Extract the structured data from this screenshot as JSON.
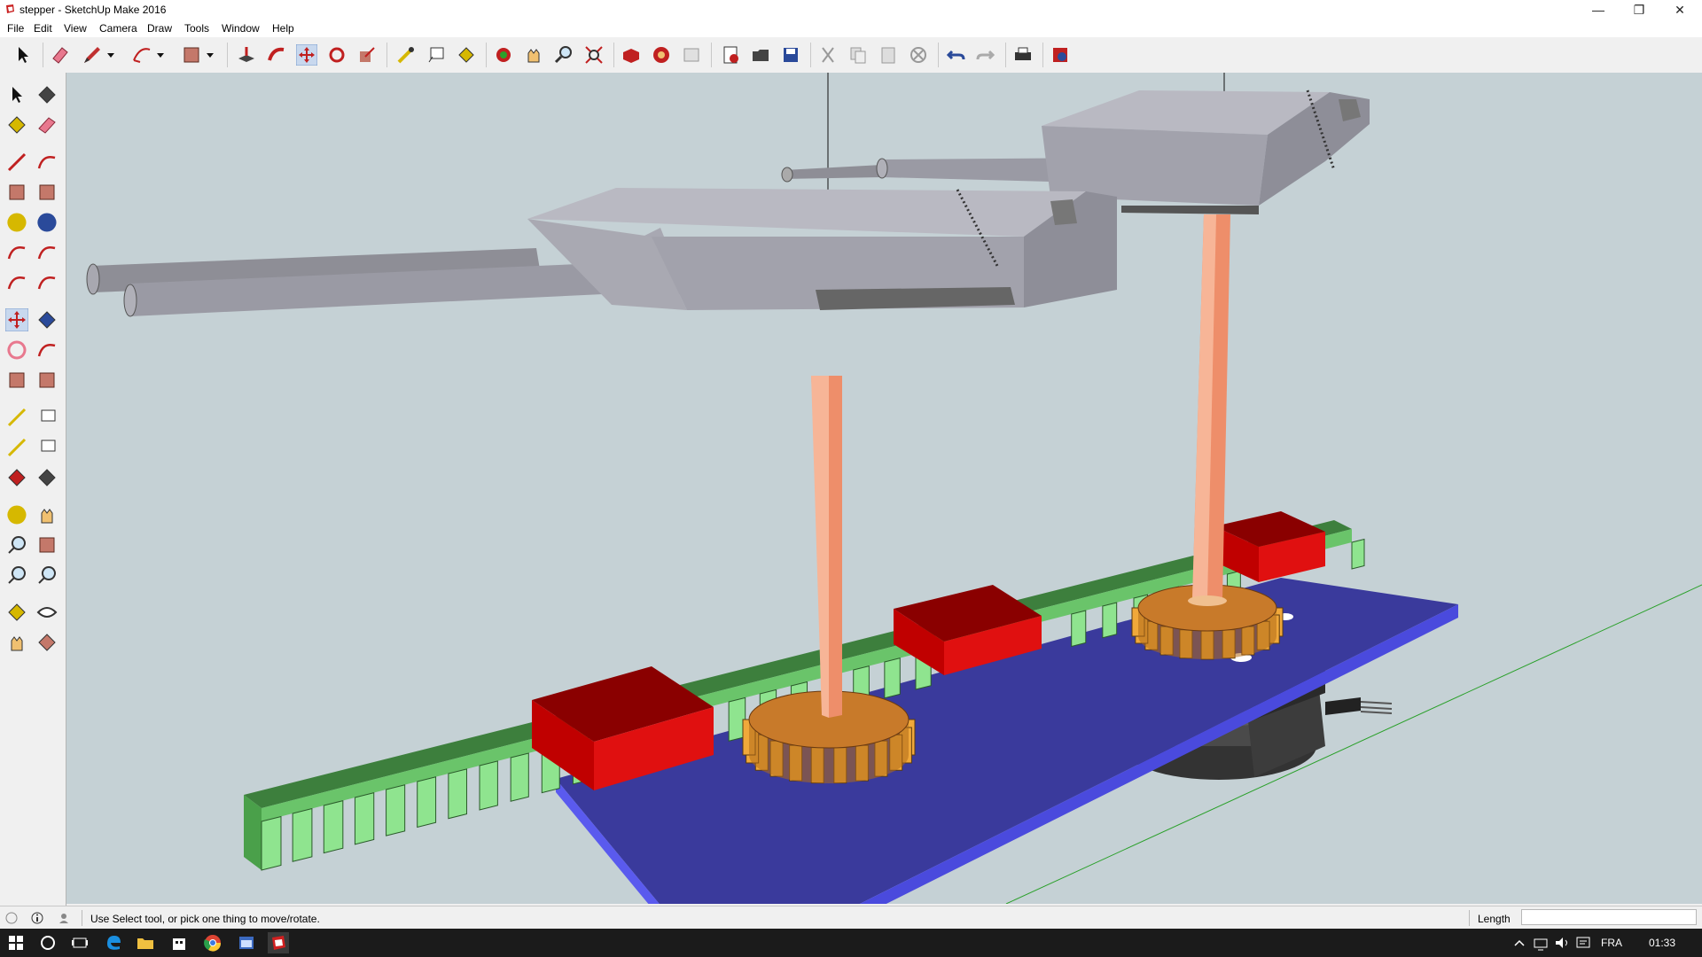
{
  "window": {
    "title": "stepper - SketchUp Make 2016",
    "icon": "sketchup-logo-icon",
    "controls": {
      "minimize": "—",
      "restore": "❐",
      "close": "✕"
    }
  },
  "menu": {
    "items": [
      "File",
      "Edit",
      "View",
      "Camera",
      "Draw",
      "Tools",
      "Window",
      "Help"
    ]
  },
  "toolbar": {
    "icons": [
      "select-icon",
      "eraser-icon",
      "pencil-icon",
      "dropdown-icon",
      "arc-icon",
      "dropdown-icon",
      "rectangle-icon",
      "dropdown-icon",
      "push-pull-icon",
      "follow-me-icon",
      "move-icon",
      "rotate-icon",
      "scale-icon",
      "tape-measure-icon",
      "text-icon",
      "paint-bucket-icon",
      "orbit-icon",
      "pan-icon",
      "zoom-icon",
      "zoom-extents-icon",
      "3d-warehouse-icon",
      "extension-warehouse-icon",
      "layout-icon",
      "new-icon",
      "open-icon",
      "save-icon",
      "cut-icon",
      "copy-icon",
      "paste-icon",
      "erase-icon",
      "undo-icon",
      "redo-icon",
      "print-icon",
      "model-info-icon"
    ]
  },
  "left_toolbar": {
    "icons": [
      "select-icon",
      "make-component-icon",
      "paint-bucket-icon",
      "eraser-icon",
      "line-icon",
      "freehand-icon",
      "rectangle-icon",
      "rotated-rectangle-icon",
      "circle-icon",
      "polygon-icon",
      "arc-icon",
      "2-point-arc-icon",
      "3-point-arc-icon",
      "pie-icon",
      "move-icon",
      "push-pull-icon",
      "rotate-icon",
      "follow-me-icon",
      "scale-icon",
      "offset-icon",
      "tape-measure-icon",
      "dimension-icon",
      "protractor-icon",
      "text-icon",
      "axes-icon",
      "3d-text-icon",
      "orbit-icon",
      "pan-icon",
      "zoom-icon",
      "zoom-window-icon",
      "zoom-extents-icon",
      "previous-view-icon",
      "position-camera-icon",
      "look-around-icon",
      "walk-icon",
      "section-plane-icon"
    ]
  },
  "status": {
    "message": "Use Select tool, or pick one thing to move/rotate.",
    "measurement_label": "Length",
    "measurement_value": ""
  },
  "taskbar": {
    "icons": [
      "windows-start-icon",
      "cortana-search-icon",
      "task-view-icon",
      "edge-icon",
      "file-explorer-icon",
      "store-icon",
      "chrome-icon",
      "app-window-icon",
      "sketchup-icon"
    ],
    "tray_icons": [
      "tray-chevron-icon",
      "network-icon",
      "volume-icon",
      "notification-icon"
    ],
    "language": "FRA",
    "time": "01:33"
  },
  "colors": {
    "viewport_bg": "#c5d1d5",
    "base_plate": "#3a3a9c",
    "rack": "#3d7f3d",
    "rack_teeth": "#8fe48f",
    "block": "#e01010",
    "gear": "#e59a2f",
    "shaft": "#ee8e6a",
    "turret": "#a2a2ac",
    "motor": "#4a4a4a"
  }
}
